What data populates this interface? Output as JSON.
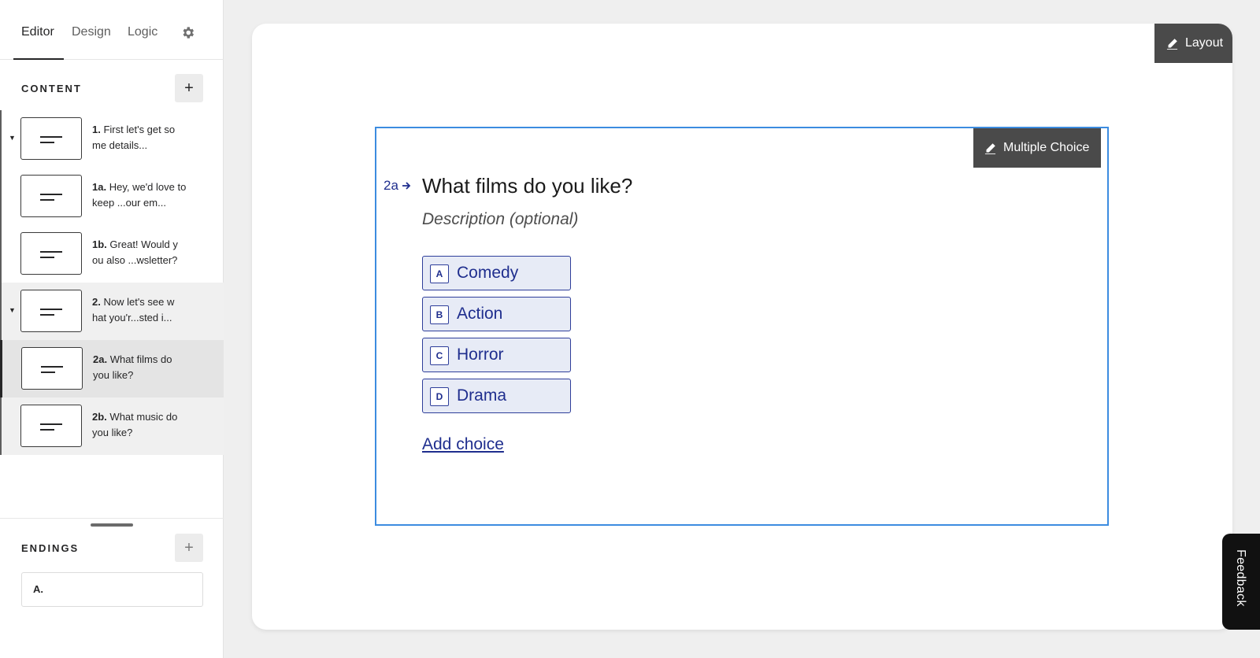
{
  "tabs": {
    "editor": "Editor",
    "design": "Design",
    "logic": "Logic"
  },
  "content": {
    "heading": "CONTENT",
    "add_label": "+",
    "items": [
      {
        "num": "1.",
        "text": "First let's get so me details...",
        "caret": true
      },
      {
        "num": "1a.",
        "text": "Hey, we'd love to keep ...our em...",
        "caret": false
      },
      {
        "num": "1b.",
        "text": "Great! Would y ou also ...wsletter?",
        "caret": false
      },
      {
        "num": "2.",
        "text": "Now let's see w hat you'r...sted i...",
        "caret": true
      },
      {
        "num": "2a.",
        "text": "What films do you like?",
        "caret": false
      },
      {
        "num": "2b.",
        "text": "What music do you like?",
        "caret": false
      }
    ]
  },
  "endings": {
    "heading": "ENDINGS",
    "add_label": "+",
    "items": [
      {
        "label": "A."
      }
    ]
  },
  "canvas": {
    "layout_label": "Layout",
    "block_type_label": "Multiple Choice",
    "question_number": "2a",
    "question_title": "What films do you like?",
    "description_placeholder": "Description (optional)",
    "choices": [
      {
        "key": "A",
        "label": "Comedy"
      },
      {
        "key": "B",
        "label": "Action"
      },
      {
        "key": "C",
        "label": "Horror"
      },
      {
        "key": "D",
        "label": "Drama"
      }
    ],
    "add_choice_label": "Add choice"
  },
  "feedback_label": "Feedback",
  "colors": {
    "accent": "#1f2e8e",
    "selection_border": "#3c8ce0",
    "choice_bg": "#e7ebf6",
    "dark_button": "#4a4a4a"
  }
}
